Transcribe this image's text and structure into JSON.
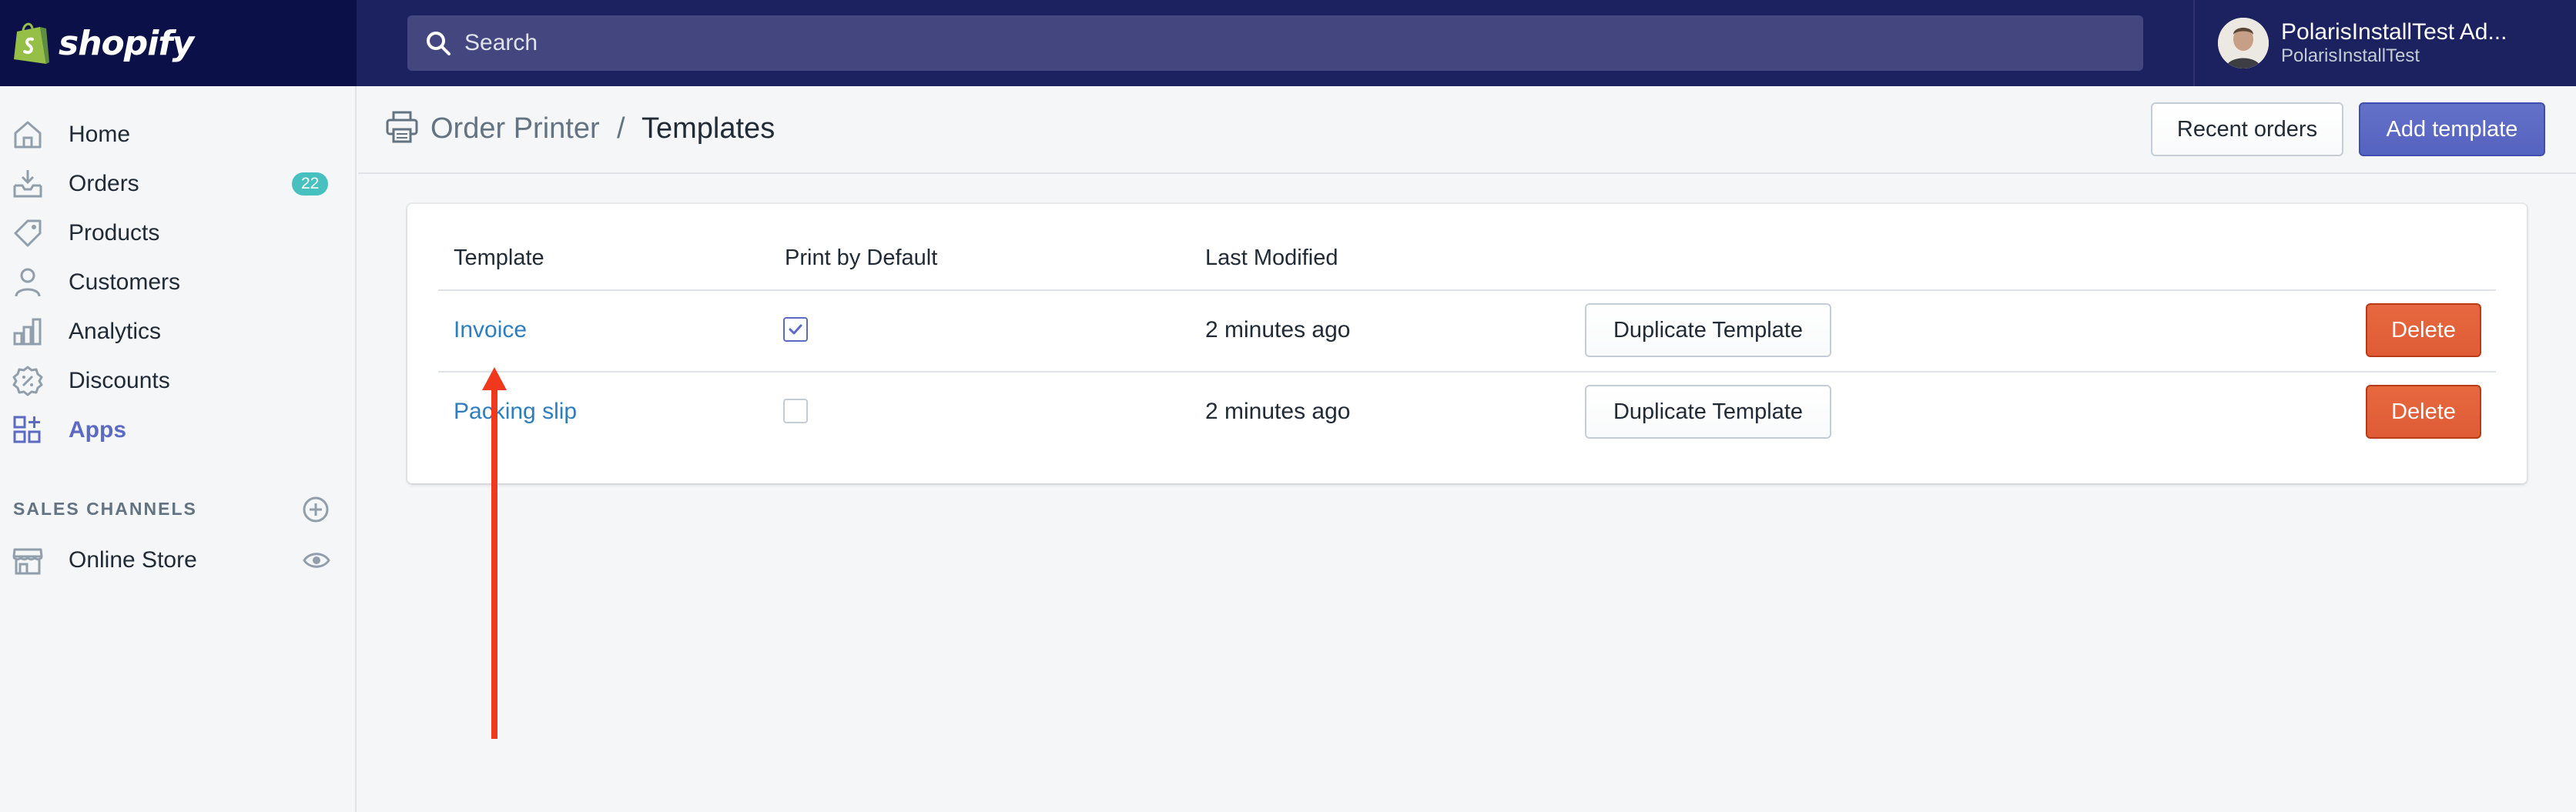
{
  "topbar": {
    "brand": "shopify",
    "search_placeholder": "Search",
    "account_name": "PolarisInstallTest Ad...",
    "account_store": "PolarisInstallTest"
  },
  "sidebar": {
    "items": [
      {
        "label": "Home",
        "icon": "home-icon"
      },
      {
        "label": "Orders",
        "icon": "orders-icon",
        "badge": "22"
      },
      {
        "label": "Products",
        "icon": "tag-icon"
      },
      {
        "label": "Customers",
        "icon": "person-icon"
      },
      {
        "label": "Analytics",
        "icon": "bar-chart-icon"
      },
      {
        "label": "Discounts",
        "icon": "discount-icon"
      },
      {
        "label": "Apps",
        "icon": "apps-icon",
        "active": true
      }
    ],
    "sales_channels_heading": "SALES CHANNELS",
    "channels": [
      {
        "label": "Online Store",
        "icon": "store-icon"
      }
    ]
  },
  "header": {
    "app_name": "Order Printer",
    "separator": "/",
    "page_title": "Templates",
    "recent_orders_label": "Recent orders",
    "add_template_label": "Add template"
  },
  "table": {
    "columns": [
      "Template",
      "Print by Default",
      "Last Modified"
    ],
    "rows": [
      {
        "name": "Invoice",
        "print_by_default": true,
        "modified": "2 minutes ago",
        "duplicate_label": "Duplicate Template",
        "delete_label": "Delete"
      },
      {
        "name": "Packing slip",
        "print_by_default": false,
        "modified": "2 minutes ago",
        "duplicate_label": "Duplicate Template",
        "delete_label": "Delete"
      }
    ]
  },
  "colors": {
    "topbar": "#1c2260",
    "accent": "#5c6ac4",
    "link": "#2d7ec0",
    "danger": "#de5c36",
    "annotation_arrow": "#f0381c",
    "badge": "#47c1bf"
  }
}
